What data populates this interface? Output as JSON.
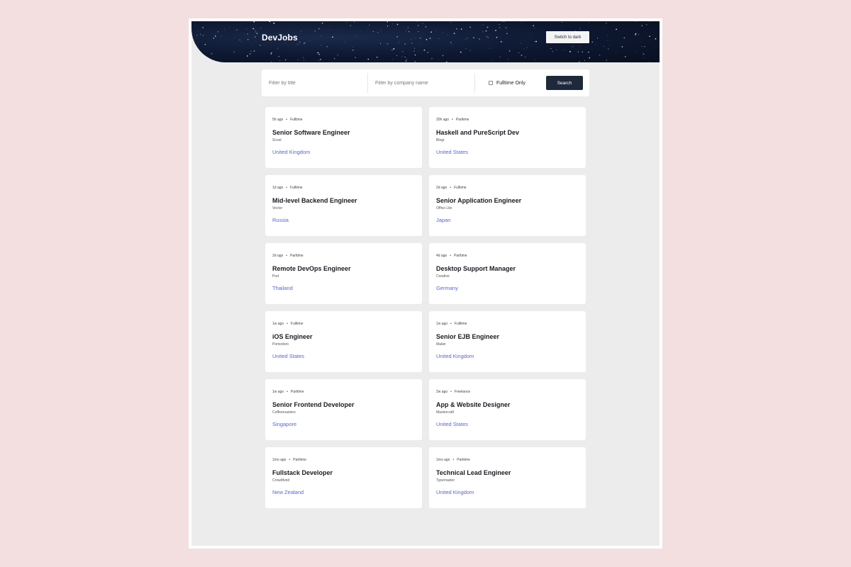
{
  "header": {
    "logo": "DevJobs",
    "theme_button": "Switch to dark"
  },
  "filters": {
    "title_placeholder": "Filter by title",
    "company_placeholder": "Filter by company name",
    "fulltime_label": "Fulltime Only",
    "search_label": "Search"
  },
  "jobs": [
    {
      "posted": "5h ago",
      "type": "Fulltime",
      "title": "Senior Software Engineer",
      "company": "Scoot",
      "location": "United Kingdom"
    },
    {
      "posted": "20h ago",
      "type": "Parttime",
      "title": "Haskell and PureScript Dev",
      "company": "Blogr",
      "location": "United States"
    },
    {
      "posted": "1d ago",
      "type": "Fulltime",
      "title": "Mid-level Backend Engineer",
      "company": "Vector",
      "location": "Russia"
    },
    {
      "posted": "2d ago",
      "type": "Fulltime",
      "title": "Senior Application Engineer",
      "company": "Office Lite",
      "location": "Japan"
    },
    {
      "posted": "2d ago",
      "type": "Parttime",
      "title": "Remote DevOps Engineer",
      "company": "Pod",
      "location": "Thailand"
    },
    {
      "posted": "4d ago",
      "type": "Parttime",
      "title": "Desktop Support Manager",
      "company": "Creative",
      "location": "Germany"
    },
    {
      "posted": "1w ago",
      "type": "Fulltime",
      "title": "iOS Engineer",
      "company": "Pomodoro",
      "location": "United States"
    },
    {
      "posted": "1w ago",
      "type": "Fulltime",
      "title": "Senior EJB Engineer",
      "company": "Maker",
      "location": "United Kingdom"
    },
    {
      "posted": "1w ago",
      "type": "Parttime",
      "title": "Senior Frontend Developer",
      "company": "Coffeeroasters",
      "location": "Singapore"
    },
    {
      "posted": "2w ago",
      "type": "Freelance",
      "title": "App & Website Designer",
      "company": "Mastercraft",
      "location": "United States"
    },
    {
      "posted": "1mo ago",
      "type": "Parttime",
      "title": "Fullstack Developer",
      "company": "Crowdfund",
      "location": "New Zealand"
    },
    {
      "posted": "1mo ago",
      "type": "Parttime",
      "title": "Technical Lead Engineer",
      "company": "Typemaster",
      "location": "United Kingdom"
    }
  ],
  "colors": {
    "page_bg": "#f3dfe0",
    "app_bg": "#ececec",
    "header_bg": "#0d1730",
    "accent_location": "#5964e0",
    "search_button": "#1e2a3b"
  }
}
